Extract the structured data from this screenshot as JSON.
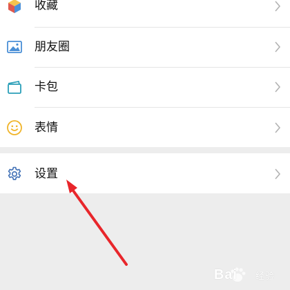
{
  "menu": {
    "items": [
      {
        "label": "收藏",
        "icon": "favorites-cube-icon"
      },
      {
        "label": "朋友圈",
        "icon": "moments-photo-icon"
      },
      {
        "label": "卡包",
        "icon": "card-wallet-icon"
      },
      {
        "label": "表情",
        "icon": "smiley-face-icon"
      }
    ],
    "settings": {
      "label": "设置",
      "icon": "gear-icon"
    }
  },
  "watermark": {
    "brand": "Bai",
    "sub": "经验"
  },
  "colors": {
    "page_background": "#ededed",
    "row_background": "#ffffff",
    "annotation_arrow": "#e8262b",
    "settings_icon": "#3f6fb5"
  }
}
